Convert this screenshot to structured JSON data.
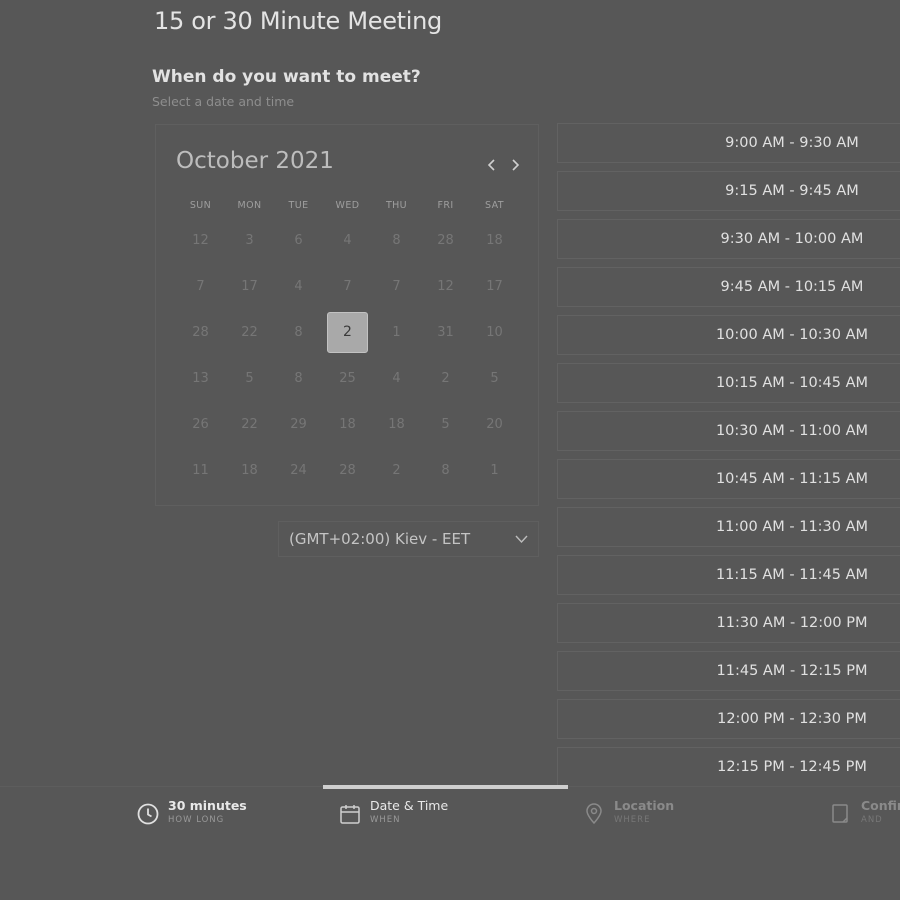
{
  "page": {
    "title": "15 or 30 Minute Meeting",
    "question": "When do you want to meet?",
    "subtitle": "Select a date and time"
  },
  "calendar": {
    "month_label": "October 2021",
    "weekdays": [
      "SUN",
      "MON",
      "TUE",
      "WED",
      "THU",
      "FRI",
      "SAT"
    ],
    "weeks": [
      [
        "12",
        "3",
        "6",
        "4",
        "8",
        "28",
        "18"
      ],
      [
        "7",
        "17",
        "4",
        "7",
        "7",
        "12",
        "17"
      ],
      [
        "28",
        "22",
        "8",
        "2",
        "1",
        "31",
        "10"
      ],
      [
        "13",
        "5",
        "8",
        "25",
        "4",
        "2",
        "5"
      ],
      [
        "26",
        "22",
        "29",
        "18",
        "18",
        "5",
        "20"
      ],
      [
        "11",
        "18",
        "24",
        "28",
        "2",
        "8",
        "1"
      ]
    ],
    "selected": {
      "week": 2,
      "day": 3
    }
  },
  "timezone": {
    "label": "(GMT+02:00) Kiev - EET"
  },
  "time_slots": [
    "9:00 AM - 9:30 AM",
    "9:15 AM - 9:45 AM",
    "9:30 AM - 10:00 AM",
    "9:45 AM - 10:15 AM",
    "10:00 AM - 10:30 AM",
    "10:15 AM - 10:45 AM",
    "10:30 AM - 11:00 AM",
    "10:45 AM - 11:15 AM",
    "11:00 AM - 11:30 AM",
    "11:15 AM - 11:45 AM",
    "11:30 AM - 12:00 PM",
    "11:45 AM - 12:15 PM",
    "12:00 PM - 12:30 PM",
    "12:15 PM - 12:45 PM"
  ],
  "steps": [
    {
      "label": "30 minutes",
      "sub": "HOW LONG",
      "icon": "clock-icon"
    },
    {
      "label": "Date & Time",
      "sub": "WHEN",
      "icon": "calendar-icon"
    },
    {
      "label": "Location",
      "sub": "WHERE",
      "icon": "location-pin-icon"
    },
    {
      "label": "Confirm",
      "sub": "AND",
      "icon": "confirm-icon"
    }
  ],
  "colors": {
    "background": "#575757",
    "selected_day": "#a9a9a9",
    "active_step_bar": "#cfcfcf"
  }
}
